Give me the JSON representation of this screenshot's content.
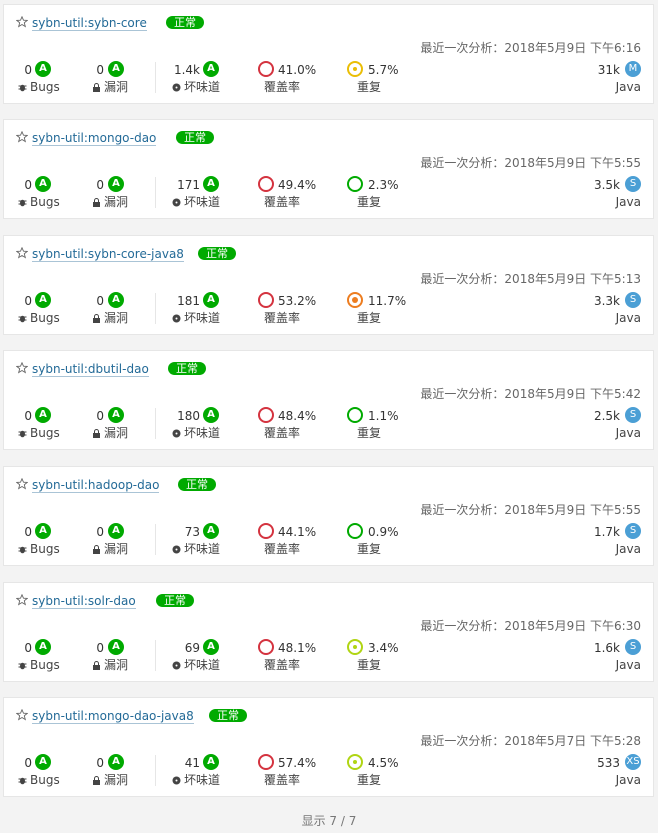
{
  "labels": {
    "bugs": "Bugs",
    "vulnerabilities": "漏洞",
    "code_smells": "坏味道",
    "coverage": "覆盖率",
    "duplications": "重复"
  },
  "colors": {
    "rating_a": "#00aa00",
    "coverage_ring": "#d4333f",
    "size_badge": "#4b9fd5",
    "quality_gate": "#00aa00",
    "link": "#236a97"
  },
  "projects": [
    {
      "name": "sybn-util:sybn-core",
      "quality_gate": "正常",
      "last_analysis": "最近一次分析：2018年5月9日 下午6:16",
      "bugs": "0",
      "bugs_rating": "A",
      "vulnerabilities": "0",
      "vulnerabilities_rating": "A",
      "code_smells": "1.4k",
      "code_smells_rating": "A",
      "coverage": "41.0%",
      "duplications": "5.7%",
      "duplications_level": "yellow",
      "size": "31k",
      "size_rating": "M",
      "language": "Java"
    },
    {
      "name": "sybn-util:mongo-dao",
      "quality_gate": "正常",
      "last_analysis": "最近一次分析：2018年5月9日 下午5:55",
      "bugs": "0",
      "bugs_rating": "A",
      "vulnerabilities": "0",
      "vulnerabilities_rating": "A",
      "code_smells": "171",
      "code_smells_rating": "A",
      "coverage": "49.4%",
      "duplications": "2.3%",
      "duplications_level": "low",
      "size": "3.5k",
      "size_rating": "S",
      "language": "Java"
    },
    {
      "name": "sybn-util:sybn-core-java8",
      "quality_gate": "正常",
      "last_analysis": "最近一次分析：2018年5月9日 下午5:13",
      "bugs": "0",
      "bugs_rating": "A",
      "vulnerabilities": "0",
      "vulnerabilities_rating": "A",
      "code_smells": "181",
      "code_smells_rating": "A",
      "coverage": "53.2%",
      "duplications": "11.7%",
      "duplications_level": "orange",
      "size": "3.3k",
      "size_rating": "S",
      "language": "Java"
    },
    {
      "name": "sybn-util:dbutil-dao",
      "quality_gate": "正常",
      "last_analysis": "最近一次分析：2018年5月9日 下午5:42",
      "bugs": "0",
      "bugs_rating": "A",
      "vulnerabilities": "0",
      "vulnerabilities_rating": "A",
      "code_smells": "180",
      "code_smells_rating": "A",
      "coverage": "48.4%",
      "duplications": "1.1%",
      "duplications_level": "low",
      "size": "2.5k",
      "size_rating": "S",
      "language": "Java"
    },
    {
      "name": "sybn-util:hadoop-dao",
      "quality_gate": "正常",
      "last_analysis": "最近一次分析：2018年5月9日 下午5:55",
      "bugs": "0",
      "bugs_rating": "A",
      "vulnerabilities": "0",
      "vulnerabilities_rating": "A",
      "code_smells": "73",
      "code_smells_rating": "A",
      "coverage": "44.1%",
      "duplications": "0.9%",
      "duplications_level": "low",
      "size": "1.7k",
      "size_rating": "S",
      "language": "Java"
    },
    {
      "name": "sybn-util:solr-dao",
      "quality_gate": "正常",
      "last_analysis": "最近一次分析：2018年5月9日 下午6:30",
      "bugs": "0",
      "bugs_rating": "A",
      "vulnerabilities": "0",
      "vulnerabilities_rating": "A",
      "code_smells": "69",
      "code_smells_rating": "A",
      "coverage": "48.1%",
      "duplications": "3.4%",
      "duplications_level": "mid",
      "size": "1.6k",
      "size_rating": "S",
      "language": "Java"
    },
    {
      "name": "sybn-util:mongo-dao-java8",
      "quality_gate": "正常",
      "last_analysis": "最近一次分析：2018年5月7日 下午5:28",
      "bugs": "0",
      "bugs_rating": "A",
      "vulnerabilities": "0",
      "vulnerabilities_rating": "A",
      "code_smells": "41",
      "code_smells_rating": "A",
      "coverage": "57.4%",
      "duplications": "4.5%",
      "duplications_level": "mid",
      "size": "533",
      "size_rating": "XS",
      "language": "Java"
    }
  ],
  "footer": "显示 7 / 7"
}
